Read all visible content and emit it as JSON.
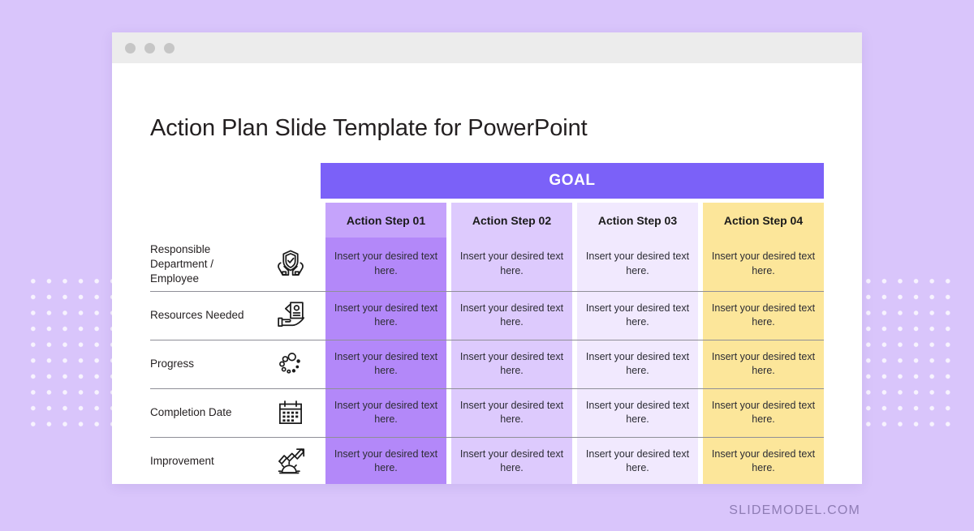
{
  "window": {
    "traffic_lights": [
      "close-dot",
      "minimize-dot",
      "maximize-dot"
    ]
  },
  "slide": {
    "title": "Action Plan Slide Template for PowerPoint",
    "goal_label": "GOAL"
  },
  "table": {
    "columns": [
      {
        "label": "Action Step 01",
        "header_color": "#c5a3fb",
        "cell_color": "#b388f9"
      },
      {
        "label": "Action Step 02",
        "header_color": "#ddcafd",
        "cell_color": "#ddcafd"
      },
      {
        "label": "Action Step 03",
        "header_color": "#f1e9fe",
        "cell_color": "#f1e9fe"
      },
      {
        "label": "Action Step 04",
        "header_color": "#fce69a",
        "cell_color": "#fce69a"
      }
    ],
    "rows": [
      {
        "label": "Responsible Department / Employee",
        "icon": "shield-hands-icon",
        "cells": [
          "Insert your desired text here.",
          "Insert your desired text here.",
          "Insert your desired text here.",
          "Insert your desired text here."
        ]
      },
      {
        "label": "Resources Needed",
        "icon": "hand-document-icon",
        "cells": [
          "Insert your desired text here.",
          "Insert your desired text here.",
          "Insert your desired text here.",
          "Insert your desired text here."
        ]
      },
      {
        "label": "Progress",
        "icon": "progress-dots-icon",
        "cells": [
          "Insert your desired text here.",
          "Insert your desired text here.",
          "Insert your desired text here.",
          "Insert your desired text here."
        ]
      },
      {
        "label": "Completion Date",
        "icon": "calendar-icon",
        "cells": [
          "Insert your desired text here.",
          "Insert your desired text here.",
          "Insert your desired text here.",
          "Insert your desired text here."
        ]
      },
      {
        "label": "Improvement",
        "icon": "arrow-gear-icon",
        "cells": [
          "Insert your desired text here.",
          "Insert your desired text here.",
          "Insert your desired text here.",
          "Insert your desired text here."
        ]
      }
    ]
  },
  "footer": {
    "brand": "SLIDEMODEL.COM"
  },
  "colors": {
    "background": "#d9c5fb",
    "goal_purple": "#7b61f8",
    "divider": "#8f8f97",
    "brand_text": "#8f7db5"
  }
}
